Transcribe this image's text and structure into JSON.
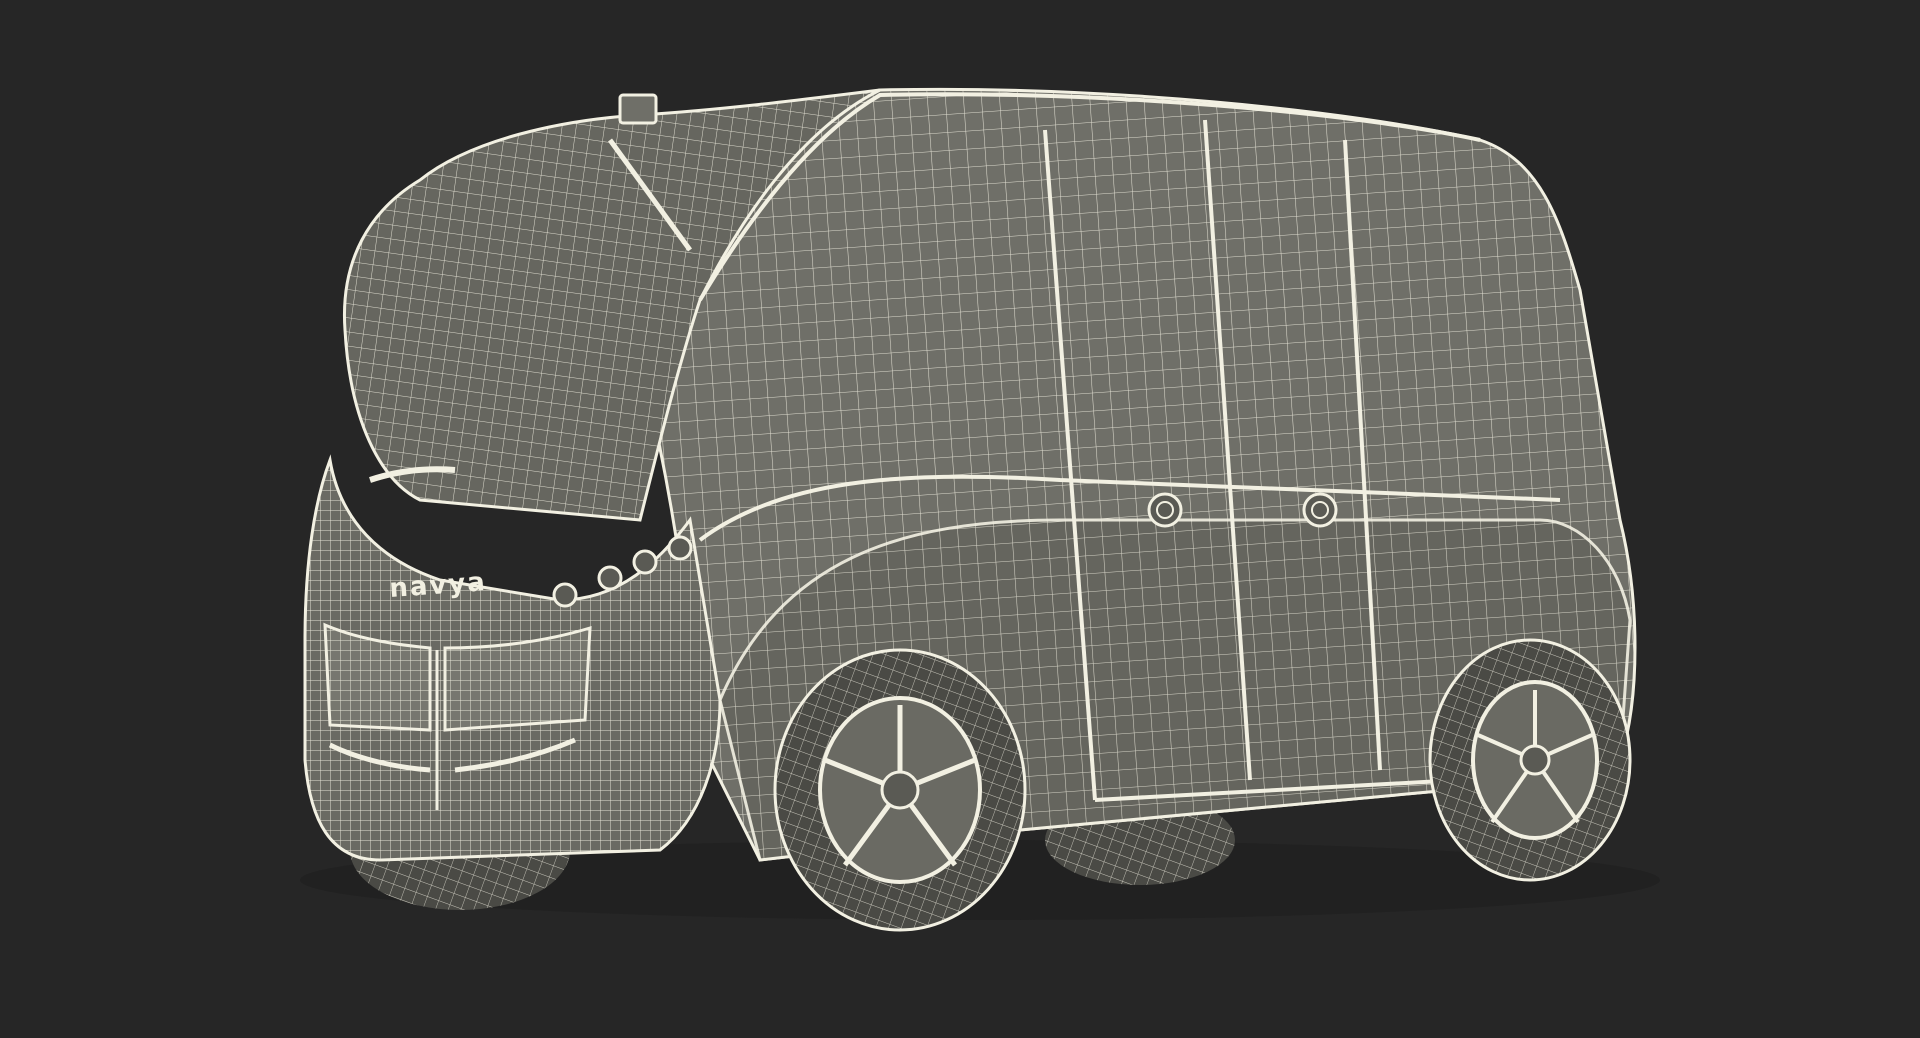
{
  "scene": {
    "subject": "autonomous-shuttle-wireframe",
    "brand_label": "navya",
    "colors": {
      "background": "#262626",
      "surface": "#6f6f68",
      "surface_dark": "#5a5a54",
      "wire": "#f2f0e2",
      "tire": "#4a4a45"
    }
  }
}
